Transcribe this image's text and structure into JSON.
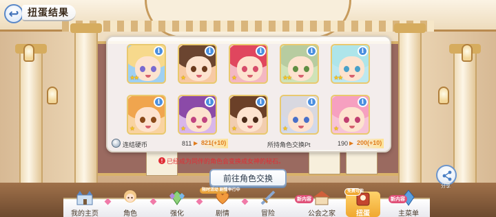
{
  "screen": {
    "title": "扭蛋结果"
  },
  "results": [
    {
      "stars": 2,
      "hair": "#f7d98c",
      "eyes": "#7a6ad0",
      "frame": "#9fd0f2"
    },
    {
      "stars": 1,
      "hair": "#6b4530",
      "eyes": "#6b3a1c",
      "frame": "#f7c9a3"
    },
    {
      "stars": 1,
      "hair": "#e0465e",
      "eyes": "#d64c6a",
      "frame": "#f4b7c2"
    },
    {
      "stars": 2,
      "hair": "#b7cca0",
      "eyes": "#5f8e42",
      "frame": "#cfe3b8"
    },
    {
      "stars": 2,
      "hair": "#aee5ea",
      "eyes": "#4aa0c8",
      "frame": "#bde8f0"
    },
    {
      "stars": 1,
      "hair": "#f0a54e",
      "eyes": "#8a4a1a",
      "frame": "#f9d3a0"
    },
    {
      "stars": 1,
      "hair": "#8b4aa8",
      "eyes": "#c04480",
      "frame": "#d9b6ea"
    },
    {
      "stars": 1,
      "hair": "#6b4028",
      "eyes": "#4a2a18",
      "frame": "#f2cdb0"
    },
    {
      "stars": 1,
      "hair": "#d8d8e0",
      "eyes": "#4a70c8",
      "frame": "#d3d9ea"
    },
    {
      "stars": 1,
      "hair": "#f6a0c0",
      "eyes": "#c04070",
      "frame": "#f7c3d7"
    }
  ],
  "info_icon": "i",
  "currency": {
    "coin_label": "连结硬币",
    "coin_before": "811",
    "coin_after": "821(+10)",
    "pt_label": "所持角色交换Pt",
    "pt_before": "190",
    "pt_after": "200(+10)"
  },
  "notice": "已经成为同伴的角色会变换成女神的秘石。",
  "exchange_button": "前往角色交换",
  "share": {
    "label": "分享",
    "icon": "share-icon"
  },
  "nav": {
    "items": [
      {
        "label": "我的主页",
        "icon": "castle-icon"
      },
      {
        "label": "角色",
        "icon": "character-icon"
      },
      {
        "label": "强化",
        "icon": "gem-icon"
      },
      {
        "label": "剧情",
        "icon": "story-heart-icon"
      },
      {
        "label": "冒险",
        "icon": "sword-icon"
      },
      {
        "label": "公会之家",
        "icon": "guild-house-icon"
      },
      {
        "label": "扭蛋",
        "icon": "gacha-icon"
      },
      {
        "label": "主菜单",
        "icon": "menu-crystal-icon"
      }
    ],
    "tags": {
      "story_tag": "限时活动 剧情举行中",
      "new_adventure": "新内容",
      "new_menu": "新内容",
      "gacha_free": "免费可能"
    }
  },
  "colors": {
    "accent": "#4a8fe0",
    "warning": "#e02d35",
    "active_tab": "#f0a830",
    "bonus": "#e07c1d"
  }
}
